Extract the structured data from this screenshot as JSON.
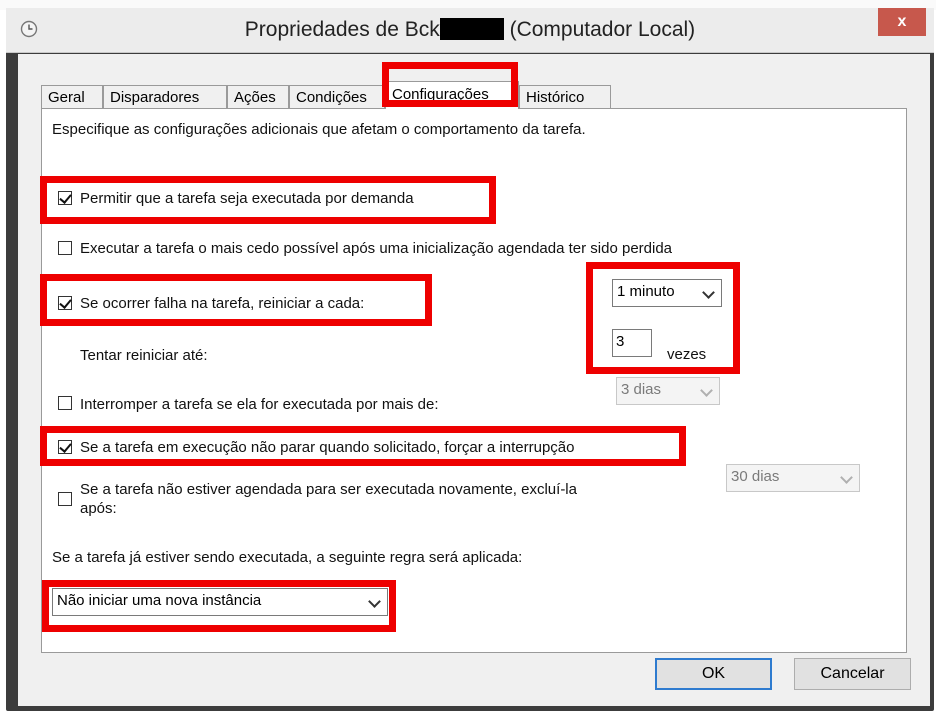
{
  "window": {
    "title_prefix": "Propriedades de Bck",
    "title_suffix": "(Computador Local)",
    "close_glyph": "x"
  },
  "tabs": [
    {
      "label": "Geral",
      "active": false
    },
    {
      "label": "Disparadores",
      "active": false
    },
    {
      "label": "Ações",
      "active": false
    },
    {
      "label": "Condições",
      "active": false
    },
    {
      "label": "Configurações",
      "active": true
    },
    {
      "label": "Histórico",
      "active": false
    }
  ],
  "settings": {
    "description": "Especifique as configurações adicionais que afetam o comportamento da tarefa.",
    "allow_on_demand": {
      "label": "Permitir que a tarefa seja executada por demanda",
      "checked": true
    },
    "run_asap": {
      "label": "Executar a tarefa o mais cedo possível após uma inicialização agendada ter sido perdida",
      "checked": false
    },
    "restart_on_failure": {
      "label": "Se ocorrer falha na tarefa, reiniciar a cada:",
      "checked": true,
      "interval": "1 minuto"
    },
    "restart_attempts": {
      "label": "Tentar reiniciar até:",
      "value": "3",
      "unit": "vezes"
    },
    "stop_if_runs_longer": {
      "label": "Interromper a tarefa se ela for executada por mais de:",
      "checked": false,
      "duration": "3 dias"
    },
    "force_stop": {
      "label": "Se a tarefa em execução não parar quando solicitado, forçar a interrupção",
      "checked": true
    },
    "delete_if_not_scheduled": {
      "label_line1": "Se a tarefa não estiver agendada para ser executada novamente, excluí-la",
      "label_line2": "após:",
      "checked": false,
      "duration": "30 dias"
    },
    "rule_label": "Se a tarefa já estiver sendo executada, a seguinte regra será aplicada:",
    "rule_value": "Não iniciar uma nova instância"
  },
  "buttons": {
    "ok": "OK",
    "cancel": "Cancelar"
  },
  "colors": {
    "highlight": "#ee0000",
    "titlebar": "#ececec",
    "close": "#c7584c"
  }
}
